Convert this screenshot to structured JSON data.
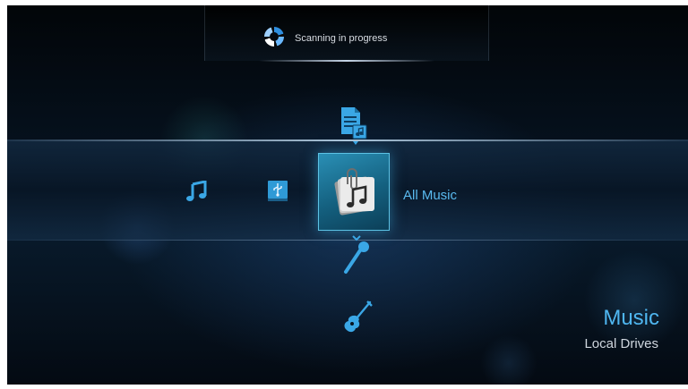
{
  "status": {
    "text": "Scanning in progress",
    "icon": "loading-spinner-icon"
  },
  "menu": {
    "items": [
      {
        "id": "playlist",
        "icon": "music-document-icon"
      },
      {
        "id": "music-note",
        "icon": "music-note-icon"
      },
      {
        "id": "usb-drive",
        "icon": "usb-drive-icon"
      },
      {
        "id": "all-music",
        "icon": "music-folder-icon",
        "label": "All Music",
        "selected": true
      },
      {
        "id": "artist",
        "icon": "microphone-icon"
      },
      {
        "id": "genre",
        "icon": "guitar-icon"
      }
    ],
    "selected_label": "All Music"
  },
  "section": {
    "title": "Music",
    "subtitle": "Local Drives"
  },
  "colors": {
    "accent": "#4fb6f0",
    "tile": "#1f7fa6",
    "icon": "#3aa7e6"
  }
}
